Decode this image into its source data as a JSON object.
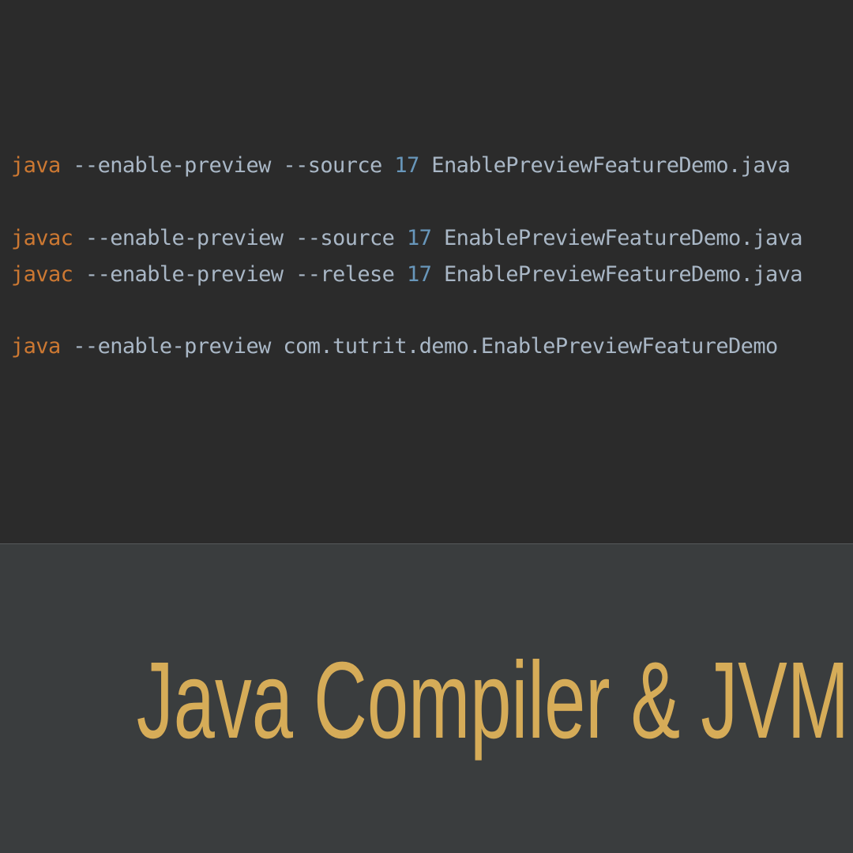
{
  "colors": {
    "code_background": "#2b2b2b",
    "title_background": "#3a3d3e",
    "keyword": "#cc7832",
    "number": "#6897bb",
    "text": "#a9b7c6",
    "title": "#d6ac58"
  },
  "code": {
    "lines": [
      {
        "command": "java",
        "flags": " --enable-preview --source ",
        "version": "17",
        "target": " EnablePreviewFeatureDemo.java"
      },
      {
        "command": "javac",
        "flags": " --enable-preview --source ",
        "version": "17",
        "target": " EnablePreviewFeatureDemo.java"
      },
      {
        "command": "javac",
        "flags": " --enable-preview --relese ",
        "version": "17",
        "target": " EnablePreviewFeatureDemo.java"
      },
      {
        "command": "java",
        "flags": " --enable-preview com.tutrit.demo.EnablePreviewFeatureDemo"
      }
    ]
  },
  "title": "Java Compiler & JVM"
}
